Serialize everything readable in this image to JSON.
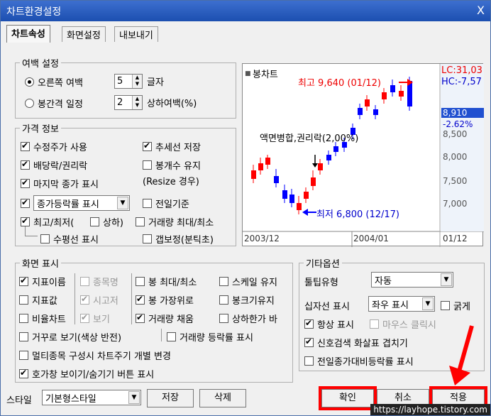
{
  "window": {
    "title": "차트환경설정",
    "close": "X"
  },
  "tabs": [
    "차트속성",
    "화면설정",
    "내보내기"
  ],
  "margin": {
    "legend": "여백 설정",
    "right_margin": {
      "label": "오른쪽 여백",
      "value": "5",
      "unit": "글자",
      "selected": true
    },
    "bar_spacing": {
      "label": "봉간격 일정",
      "value": "2",
      "unit": "상하여백(%)",
      "selected": false
    }
  },
  "price": {
    "legend": "가격 정보",
    "items": [
      {
        "label": "수정주가 사용",
        "checked": true
      },
      {
        "label": "추세선 저장",
        "checked": true
      },
      {
        "label": "배당락/권리락",
        "checked": true
      },
      {
        "label": "봉개수 유지",
        "checked": false
      },
      {
        "label": "(Resize 경우)"
      },
      {
        "label": "마지막 종가 표시",
        "checked": true
      },
      {
        "label": "종가등락률 표시",
        "checked": true
      },
      {
        "label": "전일기준",
        "checked": false
      },
      {
        "label": "최고/최저(",
        "checked": true
      },
      {
        "label": "상하)",
        "checked": false
      },
      {
        "label": "거래량 최대/최소",
        "checked": false
      },
      {
        "label": "수평선 표시",
        "checked": false
      },
      {
        "label": "갭보정(분틱초)",
        "checked": false
      }
    ]
  },
  "chart_preview": {
    "label": "봉차트",
    "lc": "LC:31,03",
    "hc": "HC:-7,57",
    "high": "최고 9,640 (01/12)",
    "low": "최저 6,800 (12/17)",
    "event": "액면병합,권리락(2,00%)",
    "current": "8,910",
    "change": "-2.62%",
    "y_ticks": [
      "8,500",
      "8,000",
      "7,500",
      "7,000"
    ],
    "x_ticks": [
      "2003/12",
      "2004/01",
      "01/12"
    ],
    "up_color": "#ff0000",
    "down_color": "#0000ff"
  },
  "screen": {
    "legend": "화면 표시",
    "items": [
      {
        "label": "지표이름",
        "checked": true
      },
      {
        "label": "종목명",
        "checked": false,
        "disabled": true
      },
      {
        "label": "봉 최대/최소",
        "checked": false
      },
      {
        "label": "스케일 유지",
        "checked": false
      },
      {
        "label": "지표값",
        "checked": false
      },
      {
        "label": "시고저",
        "checked": true,
        "disabled": true
      },
      {
        "label": "봉 가장위로",
        "checked": true
      },
      {
        "label": "봉크기유지",
        "checked": false
      },
      {
        "label": "비율차트",
        "checked": false
      },
      {
        "label": "보기",
        "checked": true,
        "disabled": true
      },
      {
        "label": "거래량 채움",
        "checked": true
      },
      {
        "label": "상하한가 바",
        "checked": false
      },
      {
        "label": "거꾸로 보기(색상 반전)",
        "checked": false
      },
      {
        "label": "거래량 등락률 표시",
        "checked": false
      },
      {
        "label": "멀티종목 구성시 차트주기 개별 변경",
        "checked": false
      },
      {
        "label": "호가창 보이기/숨기기 버튼 표시",
        "checked": true
      }
    ]
  },
  "etc": {
    "legend": "기타옵션",
    "tooltip_label": "툴팁유형",
    "tooltip_value": "자동",
    "crosshair_label": "십자선 표시",
    "crosshair_value": "좌우 표시",
    "bold": {
      "label": "굵게",
      "checked": false
    },
    "always": {
      "label": "항상 표시",
      "checked": true
    },
    "mouse": {
      "label": "마우스 클릭시",
      "checked": false,
      "disabled": true
    },
    "signal": {
      "label": "신호검색 화살표 겹치기",
      "checked": true
    },
    "prevday": {
      "label": "전일종가대비등락률 표시",
      "checked": false
    }
  },
  "bottom": {
    "style_label": "스타일",
    "style_value": "기본형스타일",
    "save": "저장",
    "delete": "삭제",
    "ok": "확인",
    "cancel": "취소",
    "apply": "적용"
  },
  "watermark": "https://layhope.tistory.com"
}
